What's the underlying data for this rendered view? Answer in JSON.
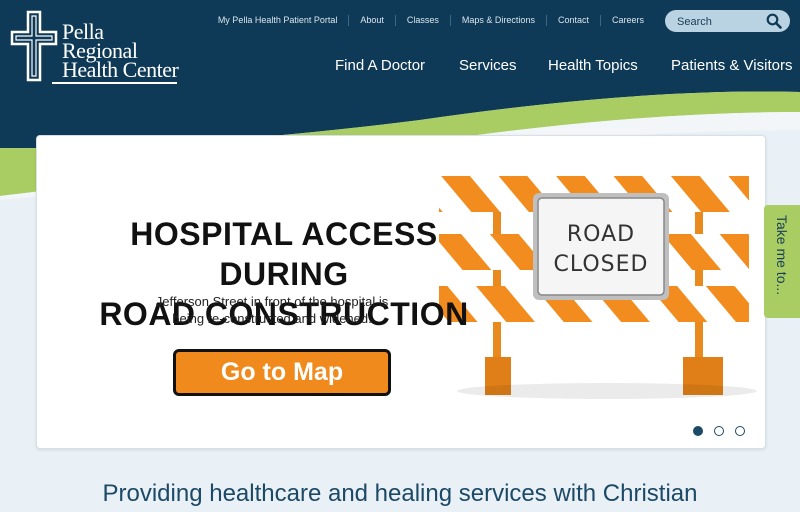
{
  "brand": {
    "logo_lines": [
      "Pella",
      "Regional",
      "Health Center"
    ]
  },
  "utility_nav": [
    "My Pella Health Patient Portal",
    "About",
    "Classes",
    "Maps & Directions",
    "Contact",
    "Careers"
  ],
  "search": {
    "placeholder": "Search"
  },
  "main_nav": [
    "Find A Doctor",
    "Services",
    "Health Topics",
    "Patients & Visitors"
  ],
  "hero": {
    "headline_line1": "HOSPITAL ACCESS DURING",
    "headline_line2": "ROAD CONSTRUCTION",
    "subtext_line1": "Jefferson Street in front of the hospital is",
    "subtext_line2": "being re-constructed and widened.",
    "cta_label": "Go to Map",
    "sign_line1": "ROAD",
    "sign_line2": "CLOSED"
  },
  "carousel": {
    "slide_count": 3,
    "active_index": 0
  },
  "side_tab": {
    "label": "Take me to..."
  },
  "tagline": "Providing healthcare and healing services with Christian",
  "colors": {
    "header_navy": "#0f3a57",
    "accent_green": "#a9cd63",
    "cta_orange": "#f08a1c"
  }
}
